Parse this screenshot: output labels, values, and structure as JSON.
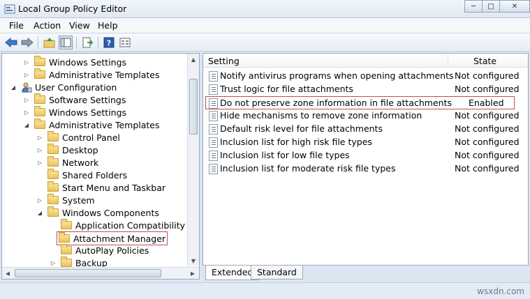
{
  "window": {
    "title": "Local Group Policy Editor",
    "minimize": "─",
    "maximize": "□",
    "close": "✕"
  },
  "menu": [
    "File",
    "Action",
    "View",
    "Help"
  ],
  "toolbar": [
    "back-icon",
    "forward-icon",
    "up-folder-icon",
    "show-hide-tree-icon",
    "export-list-icon",
    "help-icon",
    "properties-view-icon"
  ],
  "tree": [
    {
      "label": "Windows Settings",
      "expander": "▷"
    },
    {
      "label": "Administrative Templates",
      "expander": "▷"
    },
    {
      "label": "User Configuration",
      "expander": "◢"
    },
    {
      "label": "Software Settings",
      "expander": "▷"
    },
    {
      "label": "Windows Settings",
      "expander": "▷"
    },
    {
      "label": "Administrative Templates",
      "expander": "◢"
    },
    {
      "label": "Control Panel",
      "expander": "▷"
    },
    {
      "label": "Desktop",
      "expander": "▷"
    },
    {
      "label": "Network",
      "expander": "▷"
    },
    {
      "label": "Shared Folders",
      "expander": ""
    },
    {
      "label": "Start Menu and Taskbar",
      "expander": ""
    },
    {
      "label": "System",
      "expander": "▷"
    },
    {
      "label": "Windows Components",
      "expander": "◢"
    },
    {
      "label": "Application Compatibility",
      "expander": ""
    },
    {
      "label": "Attachment Manager",
      "expander": ""
    },
    {
      "label": "AutoPlay Policies",
      "expander": ""
    },
    {
      "label": "Backup",
      "expander": "▷"
    }
  ],
  "list": {
    "headers": {
      "setting": "Setting",
      "state": "State"
    },
    "rows": [
      {
        "name": "Notify antivirus programs when opening attachments",
        "state": "Not configured"
      },
      {
        "name": "Trust logic for file attachments",
        "state": "Not configured"
      },
      {
        "name": "Do not preserve zone information in file attachments",
        "state": "Enabled"
      },
      {
        "name": "Hide mechanisms to remove zone information",
        "state": "Not configured"
      },
      {
        "name": "Default risk level for file attachments",
        "state": "Not configured"
      },
      {
        "name": "Inclusion list for high risk file types",
        "state": "Not configured"
      },
      {
        "name": "Inclusion list for low file types",
        "state": "Not configured"
      },
      {
        "name": "Inclusion list for moderate risk file types",
        "state": "Not configured"
      }
    ]
  },
  "tabs": [
    "Extended",
    "Standard"
  ],
  "watermark": "wsxdn.com",
  "colors": {
    "highlight_border": "#c0504d",
    "folder": "#f3d47a"
  }
}
